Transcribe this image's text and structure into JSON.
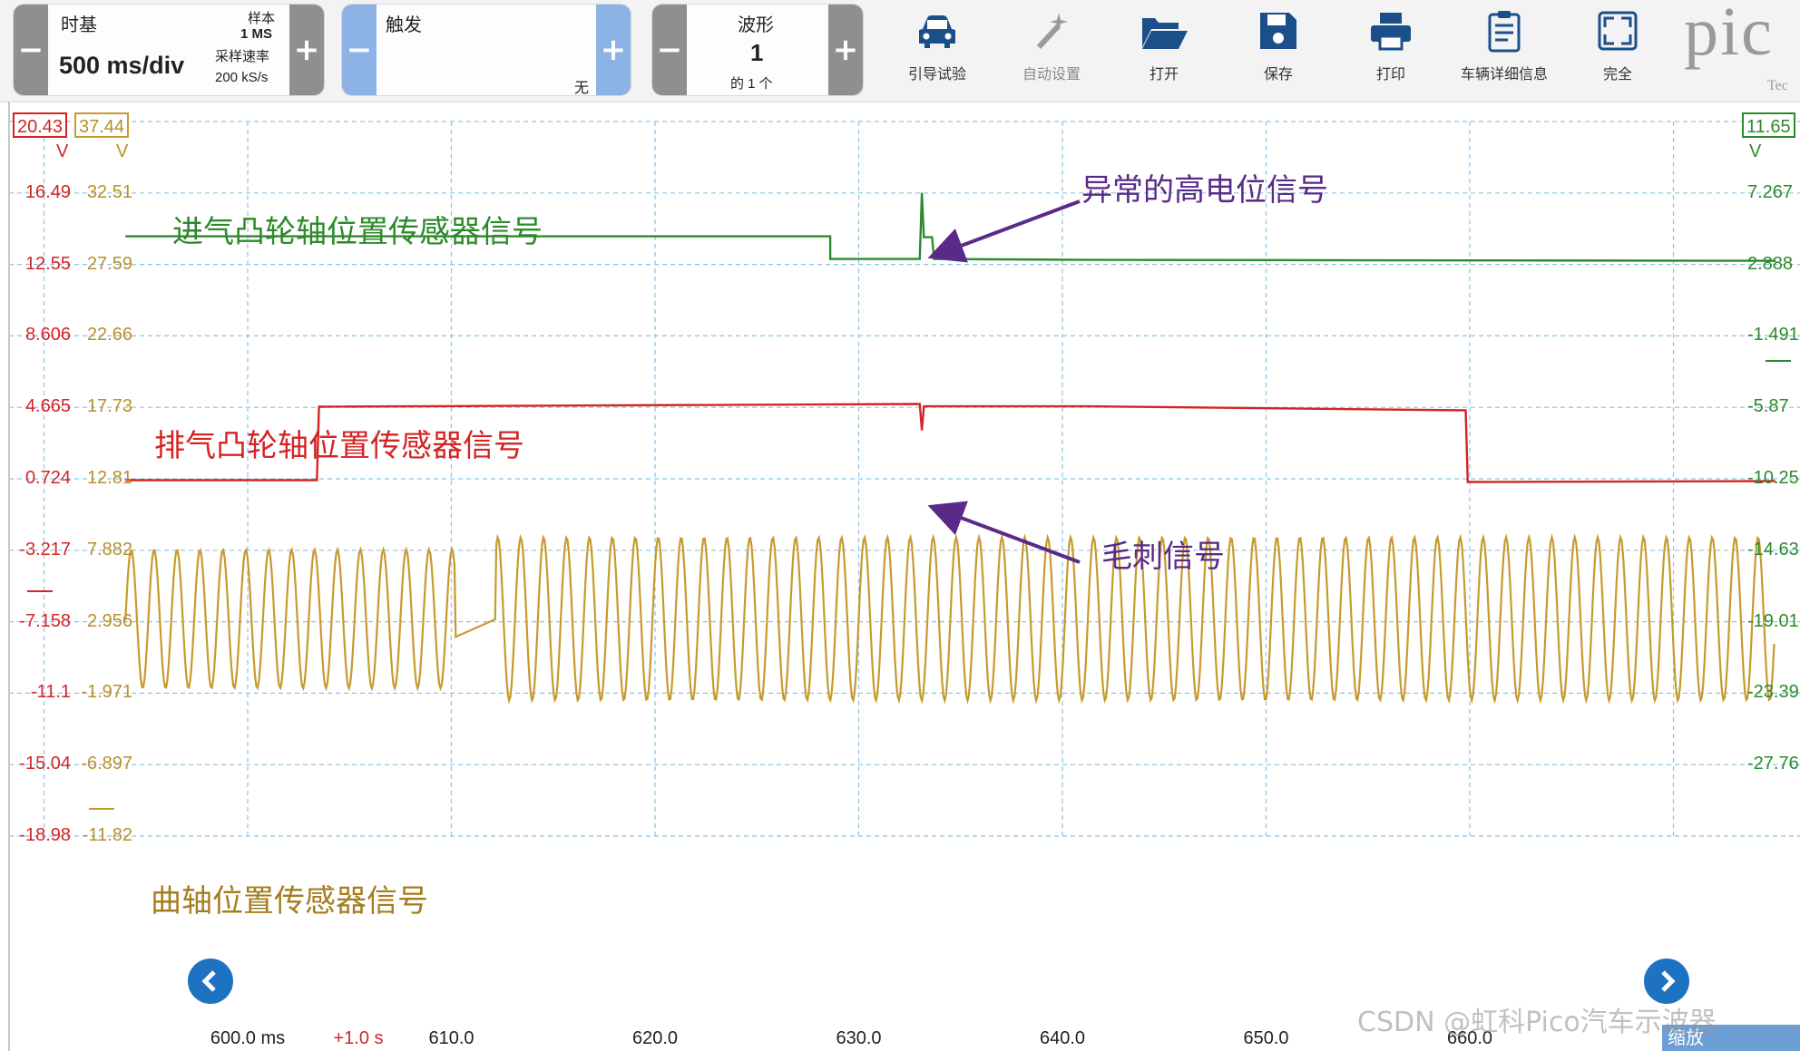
{
  "toolbar": {
    "timebase": {
      "title": "时基",
      "value": "500 ms/div",
      "samples_label": "样本",
      "samples_value": "1 MS",
      "rate_label": "采样速率",
      "rate_value": "200 kS/s",
      "minus": "−",
      "plus": "+"
    },
    "trigger": {
      "title": "触发",
      "mode": "无",
      "minus": "−",
      "plus": "+"
    },
    "waveform": {
      "title": "波形",
      "number": "1",
      "of": "的 1 个",
      "minus": "−",
      "plus": "+"
    },
    "buttons": [
      {
        "label": "引导试验",
        "icon": "car-icon",
        "enabled": true
      },
      {
        "label": "自动设置",
        "icon": "magic-wand-icon",
        "enabled": false
      },
      {
        "label": "打开",
        "icon": "folder-open-icon",
        "enabled": true
      },
      {
        "label": "保存",
        "icon": "save-icon",
        "enabled": true
      },
      {
        "label": "打印",
        "icon": "printer-icon",
        "enabled": true
      },
      {
        "label": "车辆详细信息",
        "icon": "clipboard-icon",
        "enabled": true
      },
      {
        "label": "完全",
        "icon": "fullscreen-icon",
        "enabled": true
      }
    ],
    "logo_text": "pic",
    "logo_sub": "Tec"
  },
  "axes": {
    "red_top_badge": "20.43",
    "gold_top_badge": "37.44",
    "green_top_badge": "11.65",
    "red_unit": "V",
    "gold_unit": "V",
    "green_unit": "V",
    "red_ticks": [
      "16.49",
      "12.55",
      "8.606",
      "4.665",
      "0.724",
      "-3.217",
      "-7.158",
      "-11.1",
      "-15.04",
      "-18.98"
    ],
    "gold_ticks": [
      "32.51",
      "27.59",
      "22.66",
      "17.73",
      "12.81",
      "7.882",
      "2.956",
      "-1.971",
      "-6.897",
      "-11.82"
    ],
    "green_ticks": [
      "7.267",
      "2.888",
      "-1.491",
      "-5.87",
      "-10.25",
      "-14.63",
      "-19.01",
      "-23.39",
      "-27.76"
    ],
    "time_ticks": [
      "600.0 ms",
      "610.0",
      "620.0",
      "630.0",
      "640.0",
      "650.0",
      "660.0",
      "6"
    ],
    "time_offset": "+1.0 s"
  },
  "annotations": {
    "intake": "进气凸轮轴位置传感器信号",
    "exhaust": "排气凸轮轴位置传感器信号",
    "crank": "曲轴位置传感器信号",
    "abnormal_high": "异常的高电位信号",
    "glitch": "毛刺信号"
  },
  "colors": {
    "intake": "#2c8a2c",
    "exhaust": "#d42424",
    "crank": "#c79a2e",
    "grid": "#8ec3e6",
    "arrow": "#5a2a88",
    "nav": "#1d72c2"
  },
  "zoom_tab": "缩放",
  "watermark": "CSDN @虹科Pico汽车示波器",
  "chart_data": {
    "type": "line",
    "x_unit": "ms",
    "xlim": [
      593,
      676
    ],
    "series": [
      {
        "name": "进气凸轮轴位置传感器信号",
        "points": [
          [
            594,
            14.1
          ],
          [
            628.6,
            14.1
          ],
          [
            628.6,
            12.85
          ],
          [
            633.0,
            12.85
          ],
          [
            633.1,
            16.5
          ],
          [
            633.2,
            14.05
          ],
          [
            633.6,
            14.05
          ],
          [
            633.7,
            12.85
          ],
          [
            641.4,
            12.8
          ],
          [
            675,
            12.75
          ]
        ]
      },
      {
        "name": "排气凸轮轴位置传感器信号",
        "points": [
          [
            594,
            0.65
          ],
          [
            603.4,
            0.65
          ],
          [
            603.5,
            4.7
          ],
          [
            633.0,
            4.85
          ],
          [
            633.1,
            3.4
          ],
          [
            633.2,
            4.72
          ],
          [
            641.4,
            4.72
          ],
          [
            659.8,
            4.5
          ],
          [
            659.9,
            0.55
          ],
          [
            675,
            0.6
          ]
        ]
      },
      {
        "name": "曲轴位置传感器信号",
        "approx_low_v": -11.5,
        "approx_high_v": -2.5,
        "approx_cycles": 72
      }
    ]
  }
}
